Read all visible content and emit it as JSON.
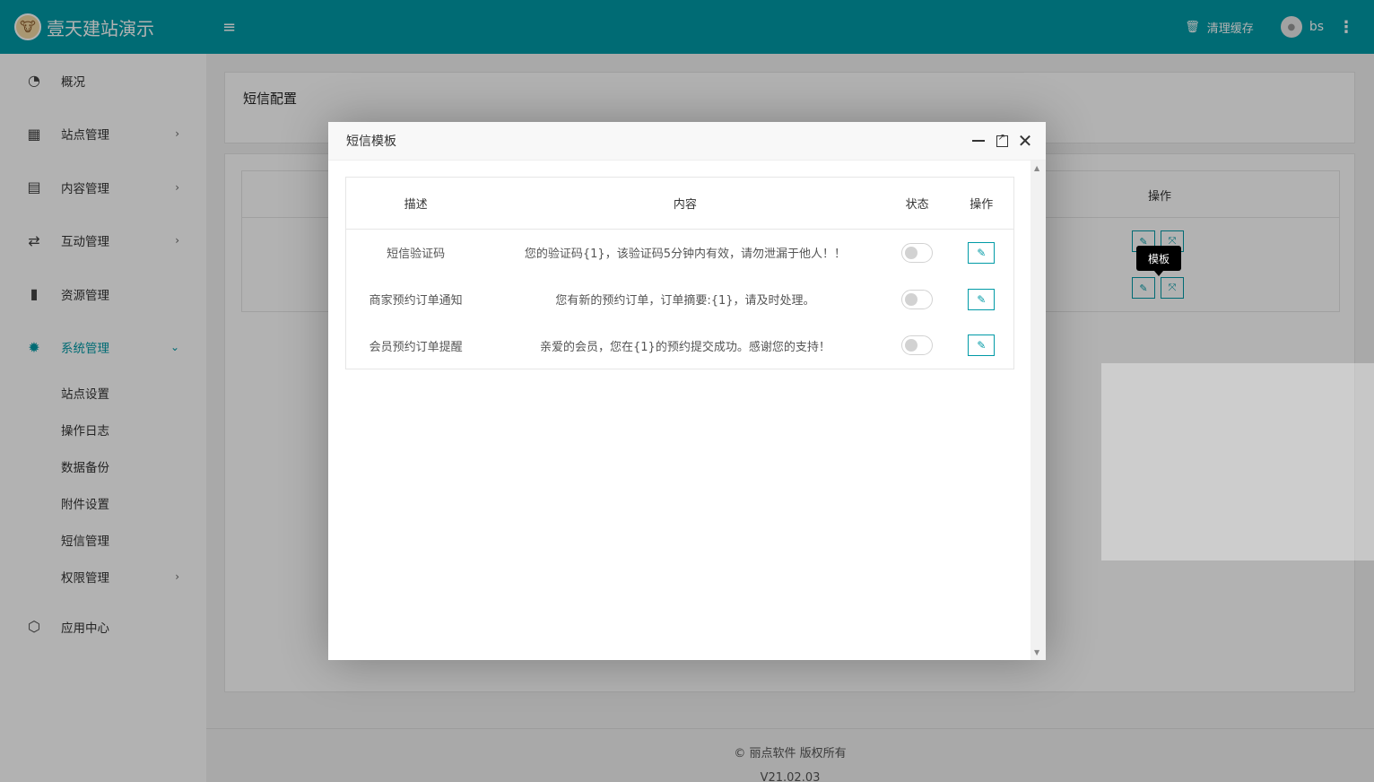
{
  "header": {
    "brand": "壹天建站演示",
    "clear_cache": "清理缓存",
    "username": "bs"
  },
  "sidebar": {
    "items": [
      {
        "label": "概况",
        "icon": "dashboard-icon"
      },
      {
        "label": "站点管理",
        "icon": "grid-icon"
      },
      {
        "label": "内容管理",
        "icon": "document-icon"
      },
      {
        "label": "互动管理",
        "icon": "handshake-icon"
      },
      {
        "label": "资源管理",
        "icon": "file-icon"
      },
      {
        "label": "系统管理",
        "icon": "gear-icon"
      },
      {
        "label": "应用中心",
        "icon": "cube-icon"
      }
    ],
    "sub_items": [
      {
        "label": "站点设置"
      },
      {
        "label": "操作日志"
      },
      {
        "label": "数据备份"
      },
      {
        "label": "附件设置"
      },
      {
        "label": "短信管理"
      },
      {
        "label": "权限管理"
      }
    ]
  },
  "page": {
    "title": "短信配置",
    "op_header": "操作",
    "tooltip": "模板"
  },
  "footer": {
    "copyright": "© 丽点软件 版权所有",
    "version": "V21.02.03"
  },
  "modal": {
    "title": "短信模板",
    "columns": {
      "desc": "描述",
      "content": "内容",
      "status": "状态",
      "op": "操作"
    },
    "rows": [
      {
        "desc": "短信验证码",
        "content": "您的验证码{1}，该验证码5分钟内有效，请勿泄漏于他人！！",
        "enabled": false
      },
      {
        "desc": "商家预约订单通知",
        "content": "您有新的预约订单，订单摘要:{1}，请及时处理。",
        "enabled": false
      },
      {
        "desc": "会员预约订单提醒",
        "content": "亲爱的会员，您在{1}的预约提交成功。感谢您的支持！",
        "enabled": false
      }
    ]
  },
  "colors": {
    "accent": "#009aa6"
  }
}
